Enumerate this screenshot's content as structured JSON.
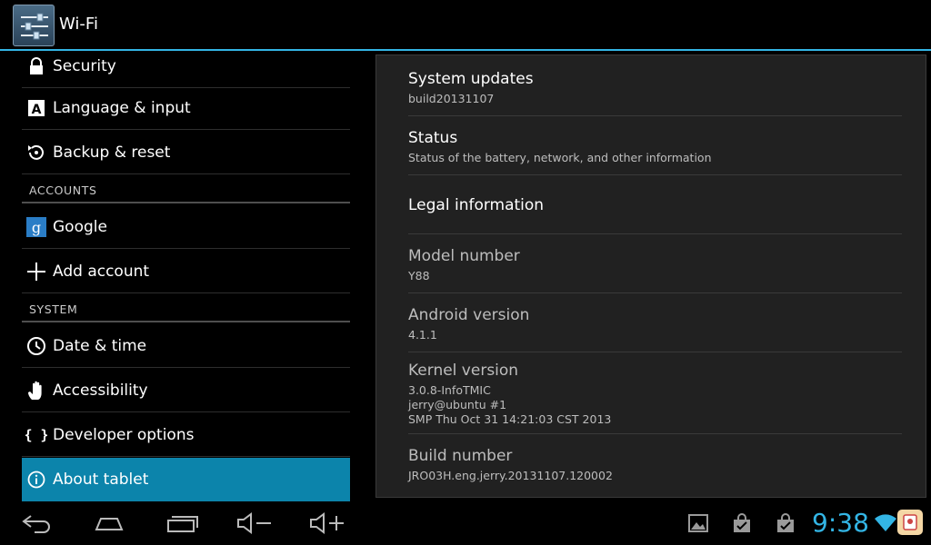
{
  "actionbar": {
    "title": "Wi-Fi",
    "icon": "settings-sliders-icon"
  },
  "sidebar": {
    "items": [
      {
        "label": "Security",
        "icon": "lock-icon"
      },
      {
        "label": "Language & input",
        "icon": "keyboard-a-icon"
      },
      {
        "label": "Backup & reset",
        "icon": "restore-icon"
      },
      {
        "label": "Google",
        "icon": "google-icon"
      },
      {
        "label": "Add account",
        "icon": "plus-icon"
      },
      {
        "label": "Date & time",
        "icon": "clock-icon"
      },
      {
        "label": "Accessibility",
        "icon": "hand-icon"
      },
      {
        "label": "Developer options",
        "icon": "braces-icon"
      },
      {
        "label": "About tablet",
        "icon": "info-icon"
      }
    ],
    "headers": {
      "accounts": "ACCOUNTS",
      "system": "SYSTEM"
    },
    "selected": "About tablet"
  },
  "about": {
    "system_updates": {
      "title": "System updates",
      "subtitle": "build20131107"
    },
    "status": {
      "title": "Status",
      "subtitle": "Status of the battery, network, and other information"
    },
    "legal": {
      "title": "Legal information"
    },
    "model": {
      "title": "Model number",
      "value": "Y88"
    },
    "android": {
      "title": "Android version",
      "value": "4.1.1"
    },
    "kernel": {
      "title": "Kernel version",
      "line1": "3.0.8-InfoTMIC",
      "line2": "jerry@ubuntu #1",
      "line3": "SMP Thu Oct 31 14:21:03 CST 2013"
    },
    "build": {
      "title": "Build number",
      "value": "JRO03H.eng.jerry.20131107.120002"
    }
  },
  "systembar": {
    "clock": "9:38",
    "nav_icons": [
      "back-icon",
      "home-icon",
      "recent-apps-icon",
      "volume-down-icon",
      "volume-up-icon"
    ],
    "notification_icons": [
      "image-icon",
      "shopping-bag-check-icon",
      "shopping-bag-check-icon",
      "wifi-icon",
      "app-notification-icon"
    ],
    "accent_color": "#33b5e5",
    "selected_color": "#0c84ab"
  }
}
